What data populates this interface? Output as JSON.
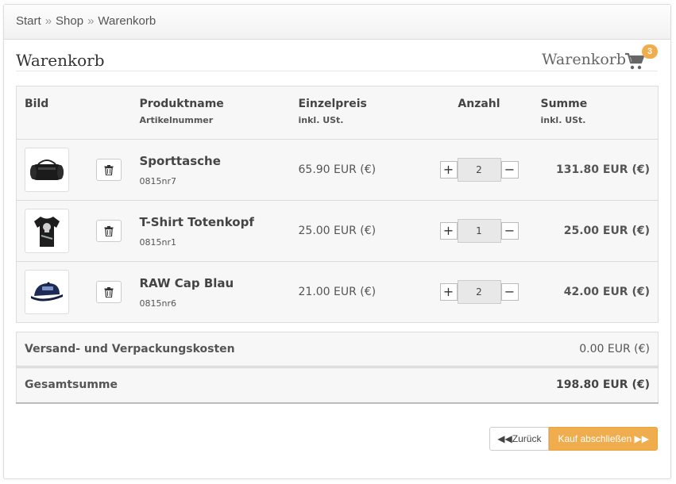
{
  "breadcrumb": {
    "items": [
      "Start",
      "Shop",
      "Warenkorb"
    ],
    "separator": "»"
  },
  "page": {
    "title": "Warenkorb",
    "cart_link": "Warenkorb",
    "cart_count": "3",
    "accent_color": "#f0ad4e"
  },
  "table": {
    "headers": {
      "image": "Bild",
      "product_name": "Produktname",
      "product_number": "Artikelnummer",
      "unit_price": "Einzelpreis",
      "unit_price_sub": "inkl. USt.",
      "quantity": "Anzahl",
      "sum": "Summe",
      "sum_sub": "inkl. USt."
    },
    "rows": [
      {
        "name": "Sporttasche",
        "number": "0815nr7",
        "unit_price": "65.90 EUR (€)",
        "quantity": "2",
        "sum": "131.80 EUR (€)",
        "image_icon": "bag-icon"
      },
      {
        "name": "T-Shirt Totenkopf",
        "number": "0815nr1",
        "unit_price": "25.00 EUR (€)",
        "quantity": "1",
        "sum": "25.00 EUR (€)",
        "image_icon": "tshirt-icon"
      },
      {
        "name": "RAW Cap Blau",
        "number": "0815nr6",
        "unit_price": "21.00 EUR (€)",
        "quantity": "2",
        "sum": "42.00 EUR (€)",
        "image_icon": "cap-icon"
      }
    ],
    "plus": "+",
    "minus": "−"
  },
  "totals": {
    "shipping_label": "Versand- und Verpackungskosten",
    "shipping_value": "0.00 EUR (€)",
    "total_label": "Gesamtsumme",
    "total_value": "198.80 EUR (€)"
  },
  "actions": {
    "back_label": "Zurück",
    "next_label": "Kauf abschließen"
  }
}
